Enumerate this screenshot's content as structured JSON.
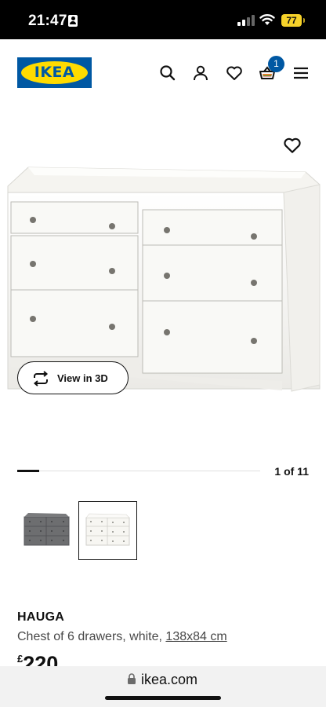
{
  "status_bar": {
    "time": "21:47",
    "battery": "77"
  },
  "header": {
    "logo": "IKEA",
    "cart_count": "1",
    "icons": [
      "search-icon",
      "account-icon",
      "wishlist-heart-icon",
      "cart-icon",
      "menu-icon"
    ]
  },
  "colors": {
    "brand_blue": "#0058a3",
    "brand_yellow": "#ffdb00",
    "battery": "#f6d22a"
  },
  "gallery": {
    "view_3d_label": "View in 3D",
    "counter": "1 of 11",
    "thumbnails": [
      {
        "variant": "dark grey",
        "selected": false
      },
      {
        "variant": "white",
        "selected": true
      }
    ]
  },
  "product": {
    "name": "HAUGA",
    "description": "Chest of 6 drawers, white,",
    "dimensions": "138x84 cm",
    "price_currency": "£",
    "price_value": "220"
  },
  "browser": {
    "url": "ikea.com"
  }
}
